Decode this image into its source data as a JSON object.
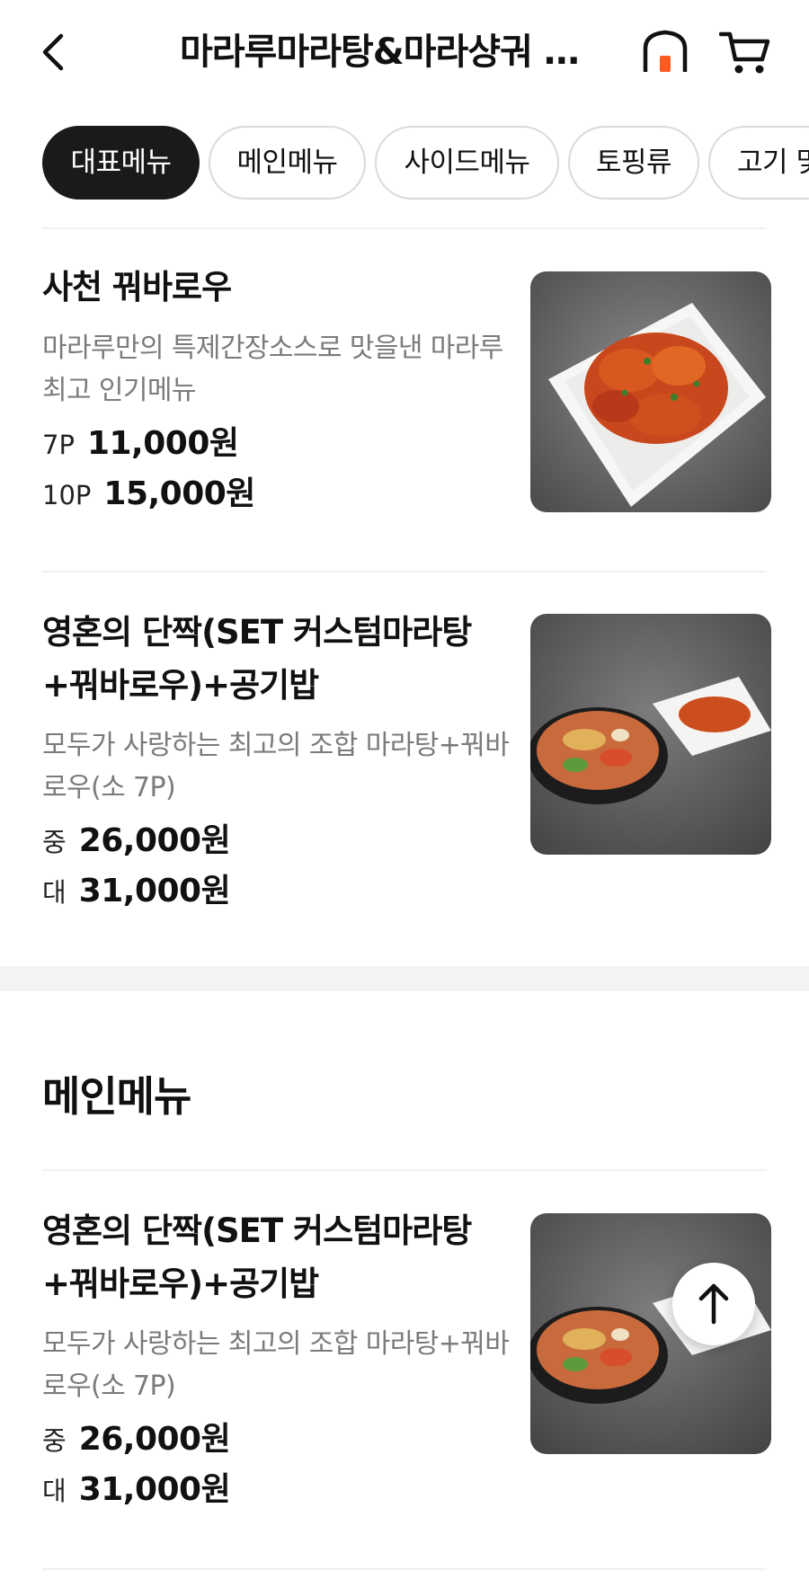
{
  "header": {
    "title": "마라루마라탕&마라샹궈 칠곡점",
    "back_icon": "chevron-left-icon",
    "home_icon": "home-icon",
    "cart_icon": "cart-icon",
    "accent": "#ff5a1f"
  },
  "tabs": [
    {
      "label": "대표메뉴",
      "active": true
    },
    {
      "label": "메인메뉴",
      "active": false
    },
    {
      "label": "사이드메뉴",
      "active": false
    },
    {
      "label": "토핑류",
      "active": false
    },
    {
      "label": "고기 및",
      "active": false
    }
  ],
  "featured": [
    {
      "name": "사천 꿔바로우",
      "desc": "마라루만의 특제간장소스로 맛을낸 마라루 최고 인기메뉴",
      "prices": [
        {
          "size": "7P",
          "amount": "11,000원"
        },
        {
          "size": "10P",
          "amount": "15,000원"
        }
      ]
    },
    {
      "name": "영혼의 단짝(SET 커스텀마라탕+꿔바로우)+공기밥",
      "desc": "모두가 사랑하는 최고의 조합 마라탕+꿔바로우(소 7P)",
      "prices": [
        {
          "size": "중",
          "amount": "26,000원"
        },
        {
          "size": "대",
          "amount": "31,000원"
        }
      ]
    }
  ],
  "main_section": {
    "title": "메인메뉴",
    "items": [
      {
        "name": "영혼의 단짝(SET 커스텀마라탕+꿔바로우)+공기밥",
        "desc": "모두가 사랑하는 최고의 조합 마라탕+꿔바로우(소 7P)",
        "prices": [
          {
            "size": "중",
            "amount": "26,000원"
          },
          {
            "size": "대",
            "amount": "31,000원"
          }
        ]
      }
    ]
  },
  "scroll_top_icon": "arrow-up-icon"
}
